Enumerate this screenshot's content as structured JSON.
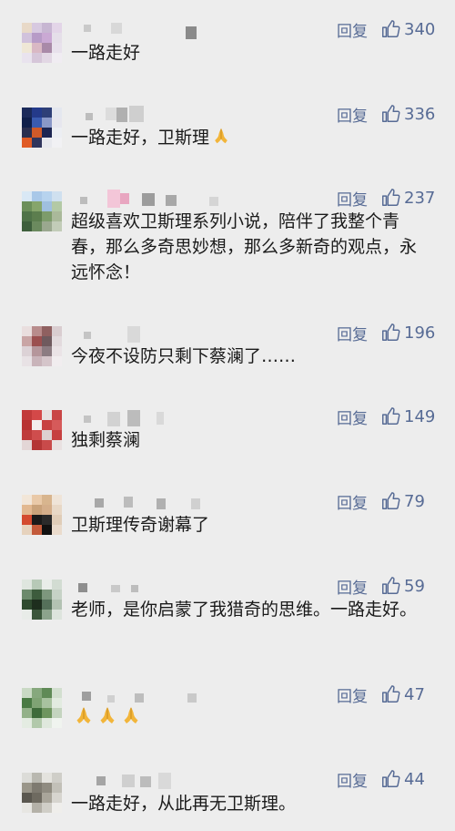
{
  "comments": [
    {
      "text": "一路走好",
      "reply_label": "回复",
      "likes": "340"
    },
    {
      "text": "一路走好，卫斯理",
      "emoji": "folded-hands",
      "reply_label": "回复",
      "likes": "336"
    },
    {
      "text": "超级喜欢卫斯理系列小说，陪伴了我整个青春，那么多奇思妙想，那么多新奇的观点，永远怀念！",
      "reply_label": "回复",
      "likes": "237"
    },
    {
      "text": "今夜不设防只剩下蔡澜了……",
      "reply_label": "回复",
      "likes": "196"
    },
    {
      "text": "独剩蔡澜",
      "reply_label": "回复",
      "likes": "149"
    },
    {
      "text": "卫斯理传奇谢幕了",
      "reply_label": "回复",
      "likes": "79"
    },
    {
      "text": "老师，是你启蒙了我猎奇的思维。一路走好。",
      "reply_label": "回复",
      "likes": "59"
    },
    {
      "text": "",
      "emoji": "folded-hands ×3",
      "reply_label": "回复",
      "likes": "47"
    },
    {
      "text": "一路走好，从此再无卫斯理。",
      "reply_label": "回复",
      "likes": "44"
    }
  ],
  "colors": {
    "background": "#ededed",
    "link": "#576b95",
    "text": "#1a1a1a"
  },
  "icons": {
    "like": "thumbs-up-icon",
    "emoji": "folded-hands-icon"
  }
}
